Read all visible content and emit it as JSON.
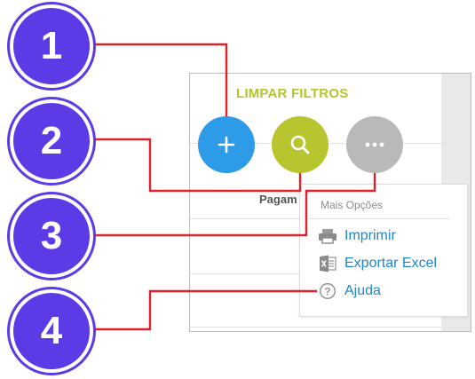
{
  "toolbar": {
    "clear_filters_label": "LIMPAR FILTROS"
  },
  "table": {
    "partial_header": "Pagam"
  },
  "buttons": {
    "add_icon": "plus-icon",
    "search_icon": "search-icon",
    "more_icon": "more-horizontal-icon",
    "add_color": "#2e9be8",
    "search_color": "#b9c52e",
    "more_color": "#b9b9b9"
  },
  "menu": {
    "title": "Mais Opções",
    "items": [
      {
        "label": "Imprimir",
        "icon": "printer-icon"
      },
      {
        "label": "Exportar Excel",
        "icon": "excel-icon"
      },
      {
        "label": "Ajuda",
        "icon": "help-circle-icon"
      }
    ]
  },
  "callouts": {
    "labels": [
      "1",
      "2",
      "3",
      "4"
    ],
    "badge_color": "#5c3be6",
    "line_color": "#e0202a"
  }
}
